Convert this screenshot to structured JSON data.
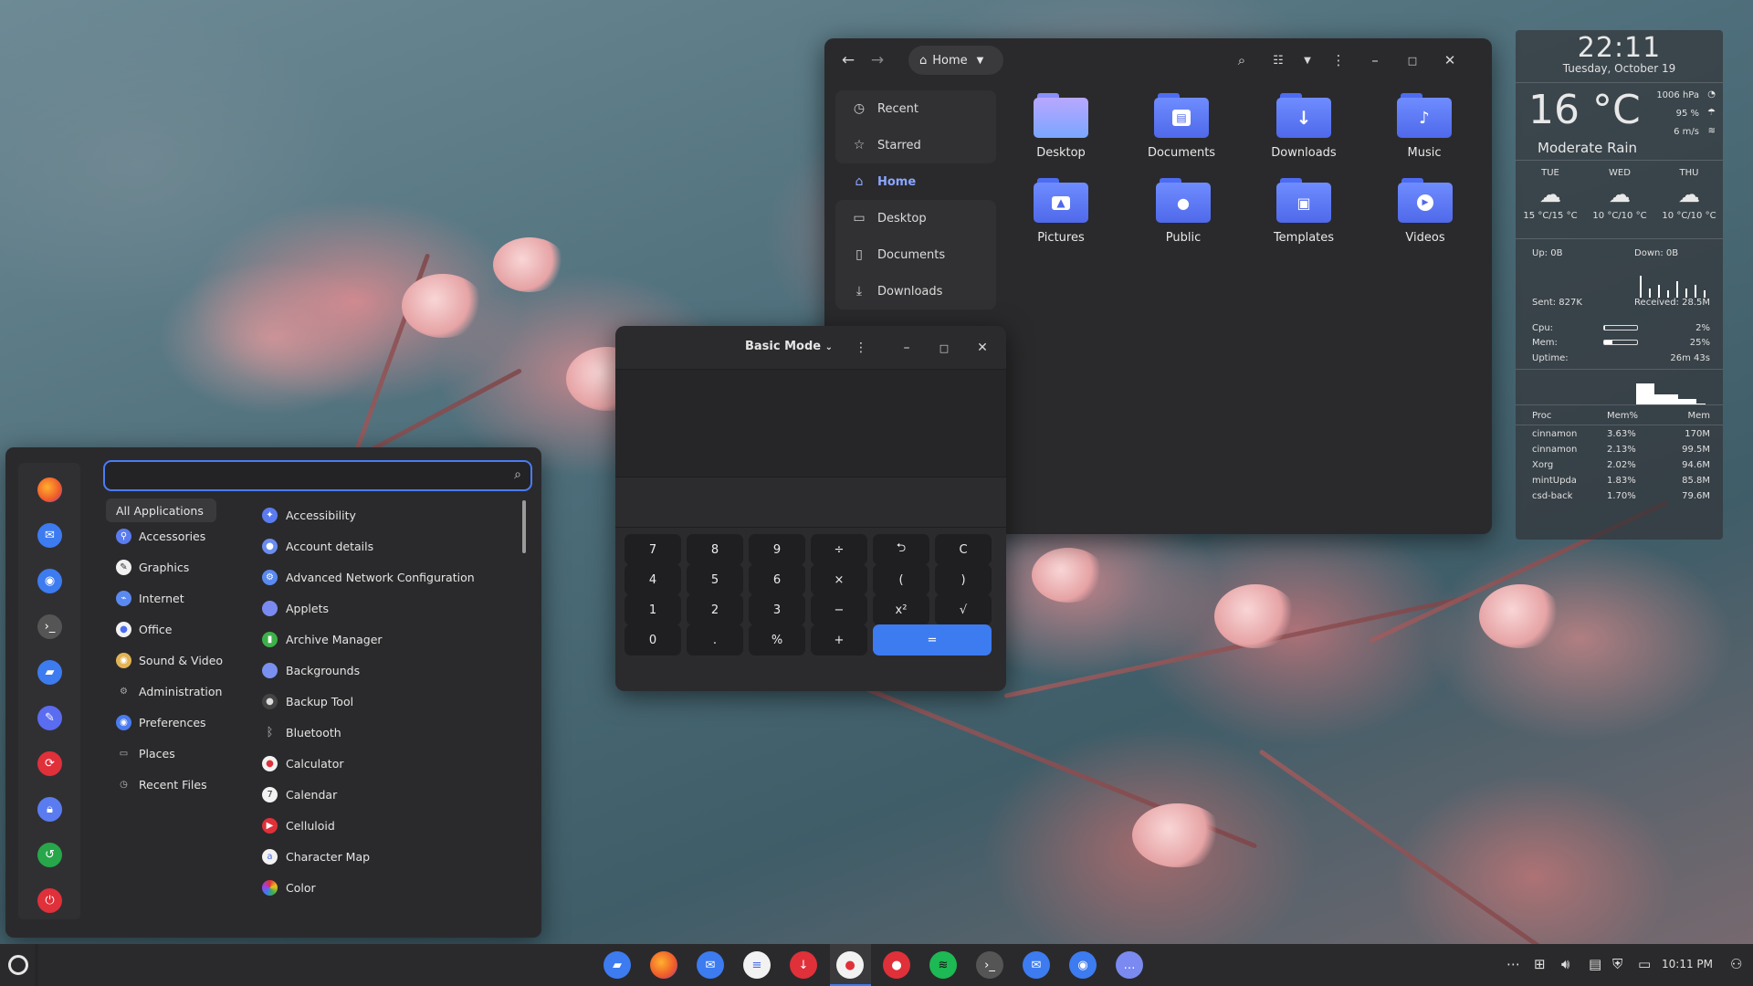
{
  "files": {
    "breadcrumb": "Home",
    "sidebar": [
      {
        "label": "Recent",
        "icon": "clock-icon"
      },
      {
        "label": "Starred",
        "icon": "star-icon"
      },
      {
        "label": "Home",
        "icon": "home-icon",
        "active": true
      },
      {
        "label": "Desktop",
        "icon": "desktop-icon"
      },
      {
        "label": "Documents",
        "icon": "document-icon"
      },
      {
        "label": "Downloads",
        "icon": "download-icon"
      }
    ],
    "folders": [
      {
        "label": "Desktop"
      },
      {
        "label": "Documents"
      },
      {
        "label": "Downloads"
      },
      {
        "label": "Music"
      },
      {
        "label": "Pictures"
      },
      {
        "label": "Public"
      },
      {
        "label": "Templates"
      },
      {
        "label": "Videos"
      }
    ]
  },
  "calculator": {
    "mode": "Basic Mode",
    "keys": [
      [
        "7",
        "8",
        "9",
        "÷",
        "⮌",
        "C"
      ],
      [
        "4",
        "5",
        "6",
        "×",
        "(",
        ")"
      ],
      [
        "1",
        "2",
        "3",
        "−",
        "x²",
        "√"
      ],
      [
        "0",
        ".",
        "%",
        "+",
        "="
      ]
    ]
  },
  "menu": {
    "search_placeholder": "",
    "categories": [
      {
        "label": "All Applications",
        "selected": true
      },
      {
        "label": "Accessories"
      },
      {
        "label": "Graphics"
      },
      {
        "label": "Internet"
      },
      {
        "label": "Office"
      },
      {
        "label": "Sound & Video"
      },
      {
        "label": "Administration"
      },
      {
        "label": "Preferences"
      },
      {
        "label": "Places"
      },
      {
        "label": "Recent Files"
      }
    ],
    "apps": [
      {
        "label": "Accessibility"
      },
      {
        "label": "Account details"
      },
      {
        "label": "Advanced Network Configuration"
      },
      {
        "label": "Applets"
      },
      {
        "label": "Archive Manager"
      },
      {
        "label": "Backgrounds"
      },
      {
        "label": "Backup Tool"
      },
      {
        "label": "Bluetooth"
      },
      {
        "label": "Calculator"
      },
      {
        "label": "Calendar"
      },
      {
        "label": "Celluloid"
      },
      {
        "label": "Character Map"
      },
      {
        "label": "Color"
      }
    ]
  },
  "desklet": {
    "time": "22:11",
    "date": "Tuesday, October 19",
    "temperature": "16 °C",
    "pressure": "1006 hPa",
    "humidity": "95 %",
    "wind": "6 m/s",
    "condition": "Moderate Rain",
    "forecast": [
      {
        "day": "TUE",
        "temps": "15 °C/15 °C"
      },
      {
        "day": "WED",
        "temps": "10 °C/10 °C"
      },
      {
        "day": "THU",
        "temps": "10 °C/10 °C"
      }
    ],
    "net_up": "Up: 0B",
    "net_down": "Down: 0B",
    "sent": "Sent: 827K",
    "received": "Received: 28.5M",
    "cpu_label": "Cpu:",
    "cpu_value": "2%",
    "cpu_fraction": 0.02,
    "mem_label": "Mem:",
    "mem_value": "25%",
    "mem_fraction": 0.25,
    "uptime_label": "Uptime:",
    "uptime_value": "26m 43s",
    "proc_headers": [
      "Proc",
      "Mem%",
      "Mem"
    ],
    "processes": [
      [
        "cinnamon",
        "3.63%",
        "170M"
      ],
      [
        "cinnamon",
        "2.13%",
        "99.5M"
      ],
      [
        "Xorg",
        "2.02%",
        "94.6M"
      ],
      [
        "mintUpda",
        "1.83%",
        "85.8M"
      ],
      [
        "csd-back",
        "1.70%",
        "79.6M"
      ]
    ]
  },
  "taskbar": {
    "clock": "10:11 PM"
  }
}
